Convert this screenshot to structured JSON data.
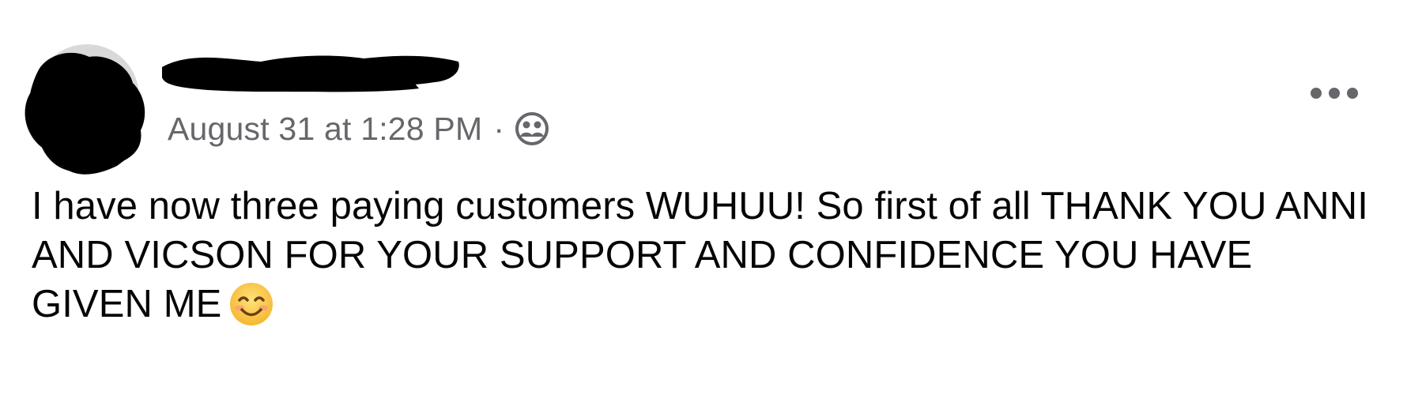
{
  "post": {
    "timestamp": "August 31 at 1:28 PM",
    "separator": "·",
    "audience_icon": "friends-icon",
    "more_icon": "more-options-icon",
    "body_text": "I have now three paying customers WUHUU! So first of all THANK YOU ANNI AND VICSON FOR YOUR SUPPORT AND CONFIDENCE YOU HAVE GIVEN ME",
    "emoji": "smiling-face-icon"
  },
  "colors": {
    "meta_text": "#65676b",
    "body_text": "#050505",
    "redaction": "#000000",
    "emoji_fill": "#f7c43c"
  }
}
